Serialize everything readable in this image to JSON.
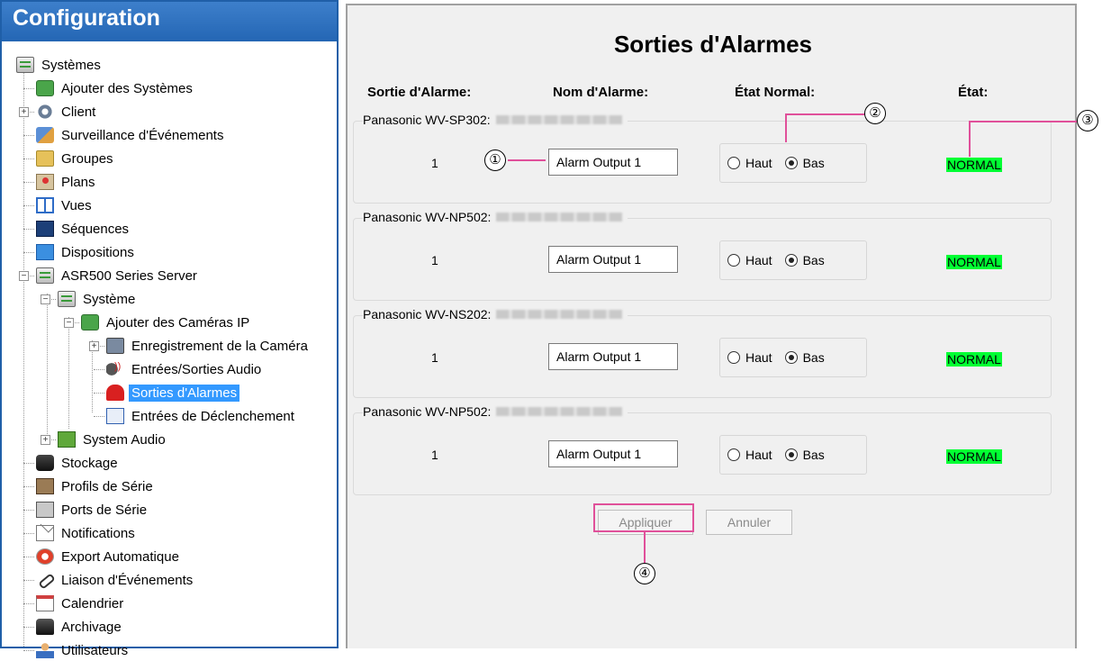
{
  "config_panel": {
    "title": "Configuration"
  },
  "tree": [
    {
      "label": "Systèmes",
      "icon": "server-icon"
    },
    {
      "label": "Ajouter des Systèmes",
      "icon": "add-system-icon"
    },
    {
      "label": "Client",
      "icon": "gear-icon",
      "expander": "+"
    },
    {
      "label": "Surveillance d'Événements",
      "icon": "event-monitor-icon"
    },
    {
      "label": "Groupes",
      "icon": "groups-icon"
    },
    {
      "label": "Plans",
      "icon": "map-icon"
    },
    {
      "label": "Vues",
      "icon": "views-icon"
    },
    {
      "label": "Séquences",
      "icon": "sequence-icon"
    },
    {
      "label": "Dispositions",
      "icon": "layout-icon"
    },
    {
      "label": "ASR500 Series Server",
      "icon": "server-gear-icon",
      "expander": "−"
    },
    {
      "label": "Système",
      "icon": "system-icon",
      "expander": "−"
    },
    {
      "label": "Ajouter des Caméras IP",
      "icon": "add-camera-icon",
      "expander": "−"
    },
    {
      "label": "Enregistrement de la Caméra",
      "icon": "camera-network-icon",
      "expander": "+"
    },
    {
      "label": "Entrées/Sorties Audio",
      "icon": "speaker-icon"
    },
    {
      "label": "Sorties d'Alarmes",
      "icon": "alarm-icon",
      "selected": true
    },
    {
      "label": "Entrées de Déclenchement",
      "icon": "trigger-icon"
    },
    {
      "label": "System Audio",
      "icon": "audio-card-icon",
      "expander": "+"
    },
    {
      "label": "Stockage",
      "icon": "storage-icon"
    },
    {
      "label": "Profils de Série",
      "icon": "serial-profile-icon"
    },
    {
      "label": "Ports de Série",
      "icon": "serial-port-icon"
    },
    {
      "label": "Notifications",
      "icon": "mail-icon"
    },
    {
      "label": "Export Automatique",
      "icon": "export-icon"
    },
    {
      "label": "Liaison d'Événements",
      "icon": "link-icon"
    },
    {
      "label": "Calendrier",
      "icon": "calendar-icon"
    },
    {
      "label": "Archivage",
      "icon": "archive-icon"
    },
    {
      "label": "Utilisateurs",
      "icon": "users-icon"
    }
  ],
  "main": {
    "title": "Sorties d'Alarmes",
    "headers": {
      "output": "Sortie d'Alarme:",
      "name": "Nom d'Alarme:",
      "normal_state": "État Normal:",
      "state": "État:"
    },
    "devices": [
      {
        "model": "Panasonic WV-SP302:",
        "number": "1",
        "alarm_name": "Alarm Output 1",
        "high_label": "Haut",
        "low_label": "Bas",
        "selected": "low",
        "status": "NORMAL"
      },
      {
        "model": "Panasonic WV-NP502:",
        "number": "1",
        "alarm_name": "Alarm Output 1",
        "high_label": "Haut",
        "low_label": "Bas",
        "selected": "low",
        "status": "NORMAL"
      },
      {
        "model": "Panasonic WV-NS202:",
        "number": "1",
        "alarm_name": "Alarm Output 1",
        "high_label": "Haut",
        "low_label": "Bas",
        "selected": "low",
        "status": "NORMAL"
      },
      {
        "model": "Panasonic WV-NP502:",
        "number": "1",
        "alarm_name": "Alarm Output 1",
        "high_label": "Haut",
        "low_label": "Bas",
        "selected": "low",
        "status": "NORMAL"
      }
    ],
    "apply_label": "Appliquer",
    "cancel_label": "Annuler"
  },
  "callouts": [
    "①",
    "②",
    "③",
    "④"
  ],
  "colors": {
    "status_bg": "#00ff33",
    "callout": "#e0509a",
    "selection": "#3399ff",
    "header": "#2466b4"
  }
}
